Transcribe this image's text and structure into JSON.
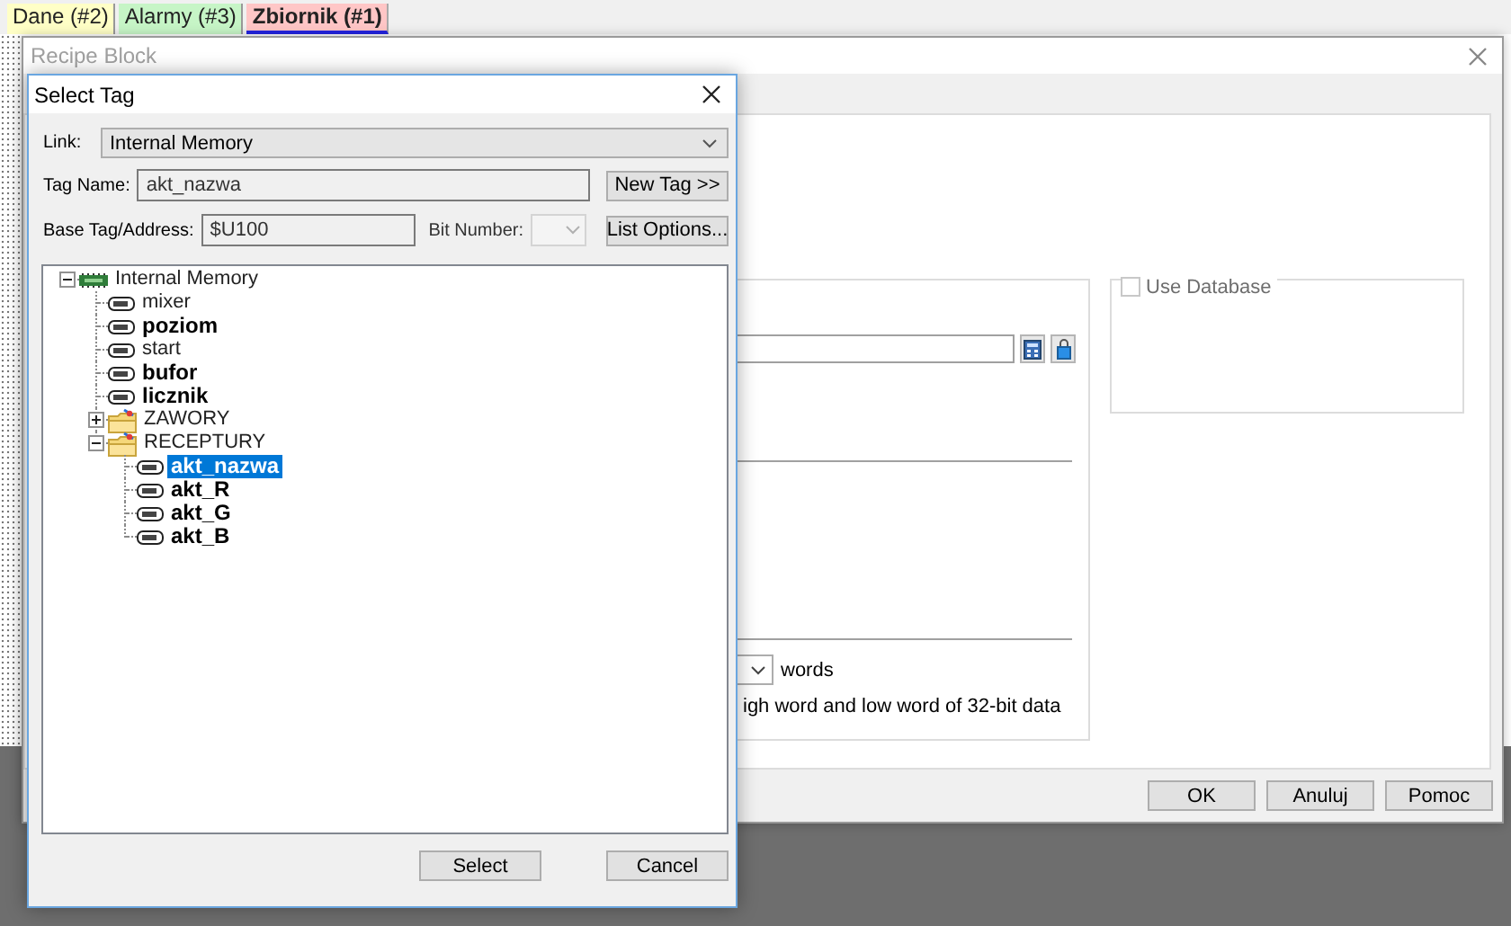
{
  "document_tabs": [
    {
      "label": "Dane (#2)",
      "selected": false,
      "color": "#ffffc6"
    },
    {
      "label": "Alarmy (#3)",
      "selected": false,
      "color": "#c6f5c6"
    },
    {
      "label": "Zbiornik (#1)",
      "selected": true,
      "color": "#ffc6c6"
    }
  ],
  "recipe_window": {
    "title": "Recipe Block",
    "units_label": "words",
    "note": "igh word and low word of 32-bit data",
    "use_database": {
      "label": "Use Database",
      "checked": false
    },
    "buttons": [
      "OK",
      "Anuluj",
      "Pomoc"
    ]
  },
  "select_tag": {
    "title": "Select Tag",
    "link": {
      "label": "Link:",
      "value": "Internal Memory"
    },
    "tag_name": {
      "label": "Tag Name:",
      "value": "akt_nazwa"
    },
    "new_tag_button": "New Tag >>",
    "base_address": {
      "label": "Base Tag/Address:",
      "value": "$U100"
    },
    "bit_number": {
      "label": "Bit Number:",
      "disabled": true
    },
    "list_options_button": "List Options...",
    "tree": [
      {
        "label": "Internal Memory",
        "kind": "memory",
        "bold": false,
        "selected": false,
        "expanded": true,
        "children": [
          {
            "label": "mixer",
            "kind": "tag",
            "bold": false,
            "selected": false
          },
          {
            "label": "poziom",
            "kind": "tag",
            "bold": true,
            "selected": false
          },
          {
            "label": "start",
            "kind": "tag",
            "bold": false,
            "selected": false
          },
          {
            "label": "bufor",
            "kind": "tag",
            "bold": true,
            "selected": false
          },
          {
            "label": "licznik",
            "kind": "tag",
            "bold": true,
            "selected": false
          },
          {
            "label": "ZAWORY",
            "kind": "folder",
            "bold": false,
            "selected": false,
            "expanded": false
          },
          {
            "label": "RECEPTURY",
            "kind": "folder",
            "bold": false,
            "selected": false,
            "expanded": true,
            "children": [
              {
                "label": "akt_nazwa",
                "kind": "tag",
                "bold": true,
                "selected": true
              },
              {
                "label": "akt_R",
                "kind": "tag",
                "bold": true,
                "selected": false
              },
              {
                "label": "akt_G",
                "kind": "tag",
                "bold": true,
                "selected": false
              },
              {
                "label": "akt_B",
                "kind": "tag",
                "bold": true,
                "selected": false
              }
            ]
          }
        ]
      }
    ],
    "buttons": [
      "Select",
      "Cancel"
    ]
  }
}
